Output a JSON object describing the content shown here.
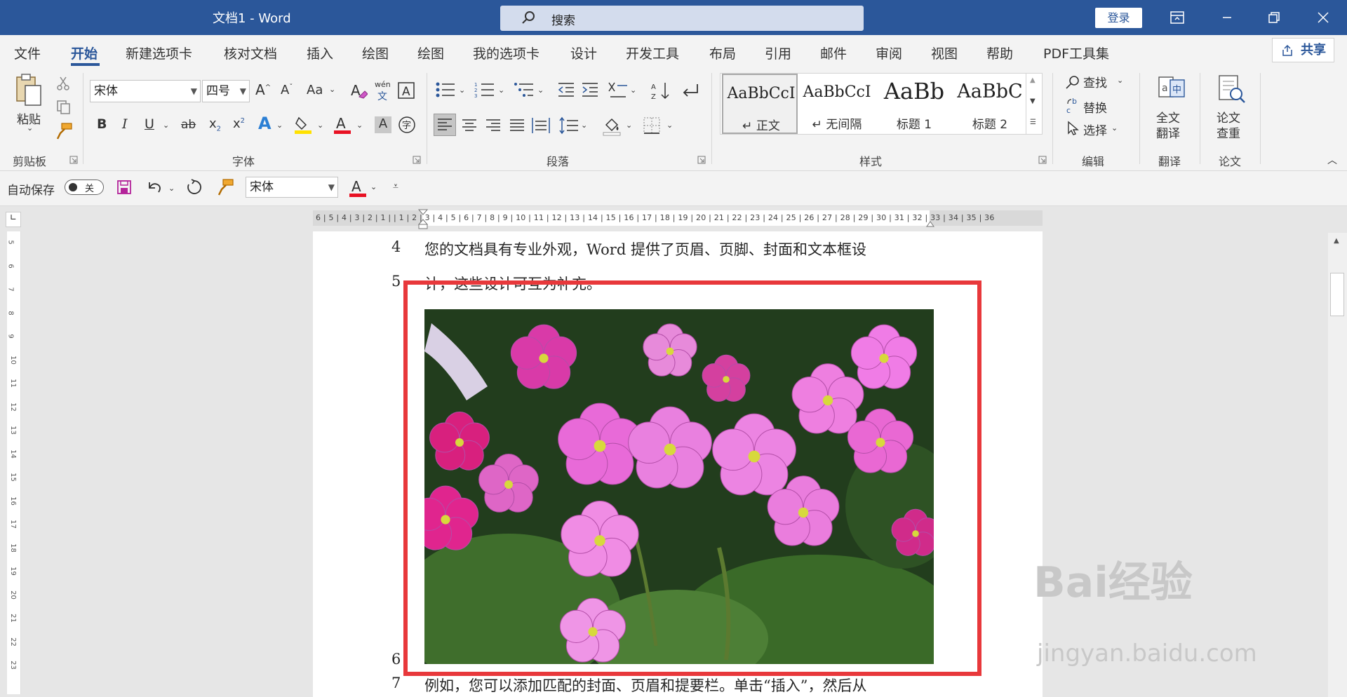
{
  "window": {
    "title": "文档1 - Word",
    "login_label": "登录",
    "accent": "#2b579a"
  },
  "search": {
    "placeholder": "搜索"
  },
  "menu": {
    "tabs": [
      "文件",
      "开始",
      "新建选项卡",
      "核对文档",
      "插入",
      "绘图",
      "绘图",
      "我的选项卡",
      "设计",
      "开发工具",
      "布局",
      "引用",
      "邮件",
      "审阅",
      "视图",
      "帮助",
      "PDF工具集"
    ],
    "active": "开始",
    "share_label": "共享"
  },
  "ribbon": {
    "clipboard": {
      "paste_label": "粘贴",
      "group_label": "剪贴板"
    },
    "font": {
      "name": "宋体",
      "size": "四号",
      "group_label": "字体",
      "pinyin_top": "wén",
      "pinyin_bottom": "文",
      "aa_label": "Aa"
    },
    "paragraph": {
      "group_label": "段落"
    },
    "styles": {
      "group_label": "样式",
      "items": [
        {
          "sample": "AaBbCcI",
          "name": "正文"
        },
        {
          "sample": "AaBbCcI",
          "name": "无间隔"
        },
        {
          "sample": "AaBb",
          "name": "标题 1"
        },
        {
          "sample": "AaBbC",
          "name": "标题 2"
        }
      ]
    },
    "editing": {
      "find_label": "查找",
      "replace_label": "替换",
      "select_label": "选择",
      "group_label": "编辑"
    },
    "translate": {
      "line1": "全文",
      "line2": "翻译",
      "group_label": "翻译"
    },
    "paper": {
      "line1": "论文",
      "line2": "查重",
      "group_label": "论文"
    }
  },
  "qat": {
    "autosave_label": "自动保存",
    "toggle_state": "关",
    "font_name": "宋体"
  },
  "ruler": {
    "h_text": "6 | 5 | 4 | 3 | 2 | 1 |   | 1 | 2 | 3 | 4 | 5 | 6 | 7 | 8 | 9 | 10 | 11 | 12 | 13 | 14 | 15 | 16 | 17 | 18 | 19 | 20 | 21 | 22 | 23 | 24 | 25 | 26 | 27 | 28 | 29 | 30 | 31 | 32 | 33 | 34 | 35 | 36",
    "v_numbers": [
      "5",
      "6",
      "7",
      "8",
      "9",
      "10",
      "11",
      "12",
      "13",
      "14",
      "15",
      "16",
      "17",
      "18",
      "19",
      "20",
      "21",
      "22",
      "23"
    ]
  },
  "document": {
    "lines": [
      {
        "num": "4",
        "text": "您的文档具有专业外观，Word 提供了页眉、页脚、封面和文本框设"
      },
      {
        "num": "5",
        "text": "计，这些设计可互为补充。"
      },
      {
        "num": "6",
        "text": ""
      },
      {
        "num": "7",
        "text": "例如，您可以添加匹配的封面、页眉和提要栏。单击“插入”，然后从"
      }
    ]
  },
  "watermark": {
    "brand": "Bai经验",
    "url": "jingyan.baidu.com"
  }
}
